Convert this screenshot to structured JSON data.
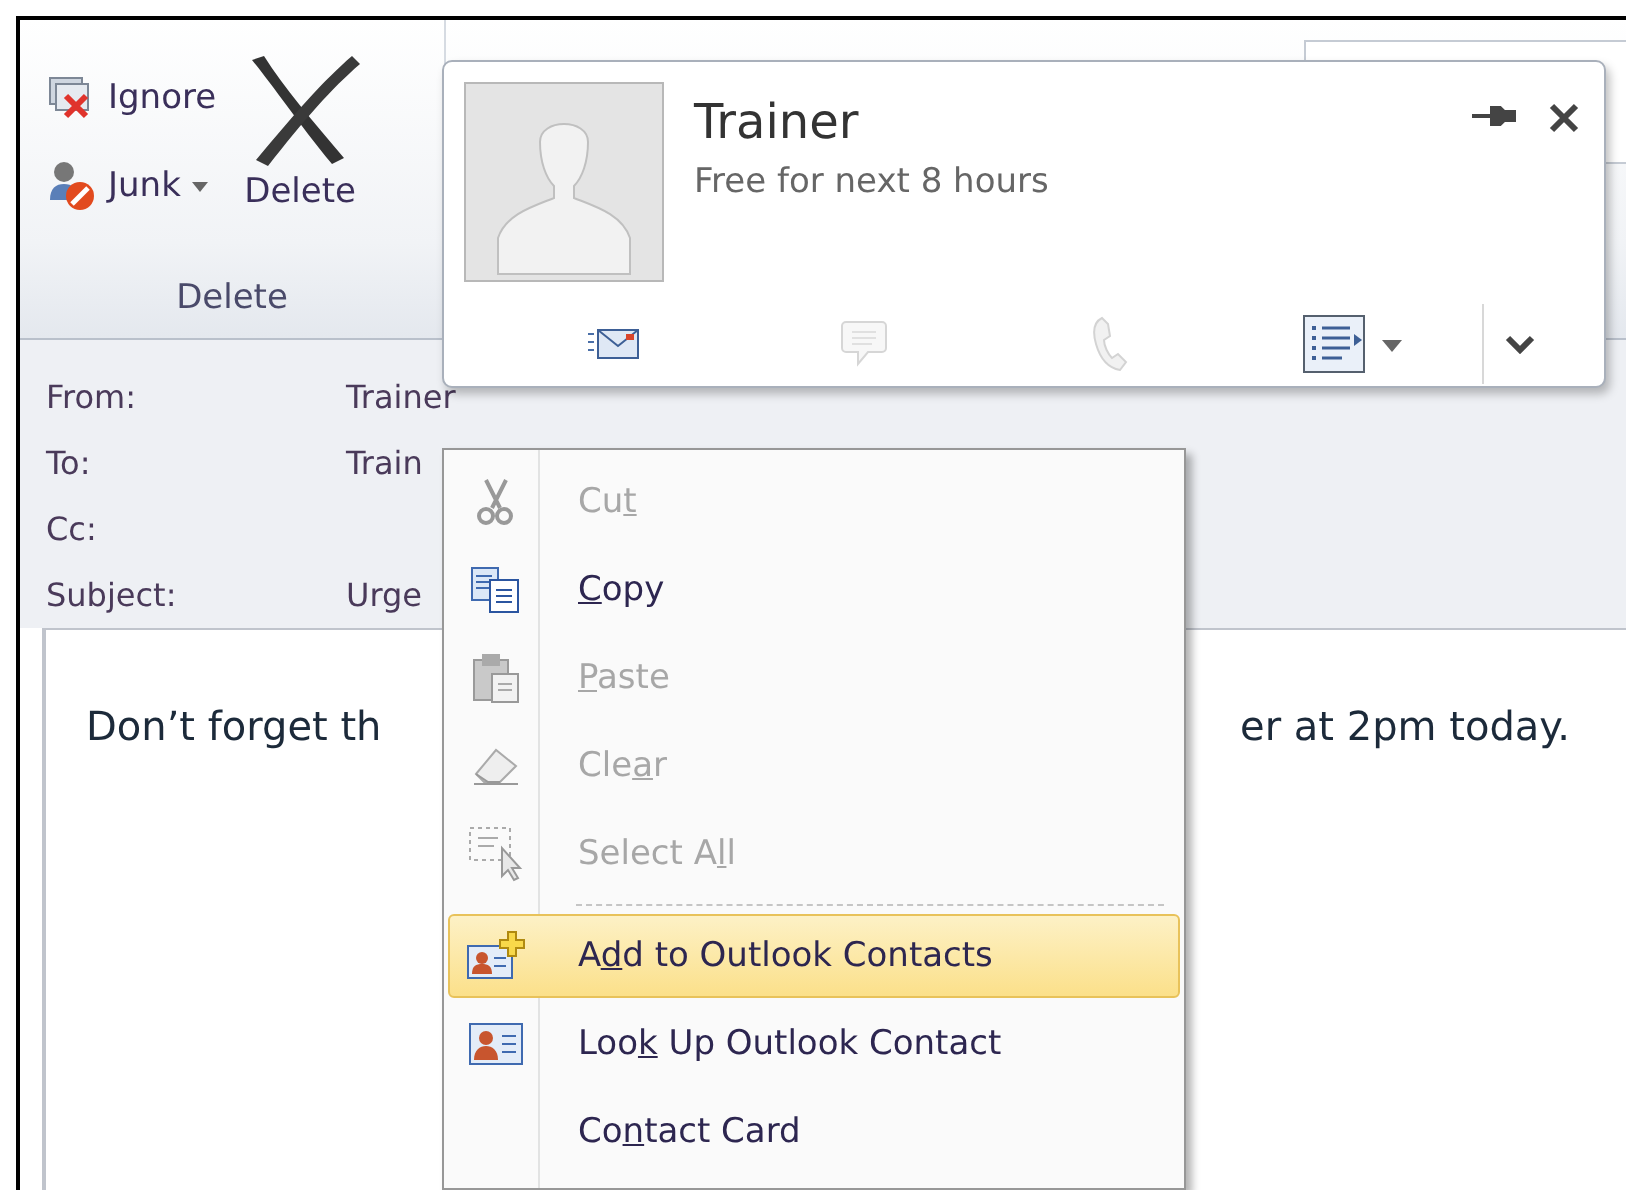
{
  "ribbon": {
    "group_label": "Delete",
    "buttons": [
      {
        "kind": "ignore",
        "label": "Ignore"
      },
      {
        "kind": "junk",
        "label": "Junk",
        "dropdown": true
      },
      {
        "kind": "delete",
        "label": "Delete"
      }
    ]
  },
  "contact_card": {
    "name": "Trainer",
    "status": "Free for next 8 hours",
    "actions": [
      {
        "kind": "email",
        "disabled": false
      },
      {
        "kind": "chat",
        "disabled": true
      },
      {
        "kind": "phone",
        "disabled": true
      },
      {
        "kind": "details",
        "disabled": false
      }
    ]
  },
  "header": {
    "fields": [
      {
        "label": "From:",
        "value": "Trainer"
      },
      {
        "label": "To:",
        "value": "Train"
      },
      {
        "label": "Cc:"
      },
      {
        "label": "Subject:",
        "value": "Urge"
      }
    ]
  },
  "body": {
    "text_left": "Don’t forget th",
    "text_right": "er at 2pm today."
  },
  "context_menu": {
    "items": [
      {
        "kind": "cut",
        "label": {
          "before": "Cu",
          "key": "t"
        },
        "disabled": true,
        "selected": false
      },
      {
        "kind": "copy",
        "label": {
          "key": "C",
          "after": "opy"
        },
        "disabled": false,
        "selected": false
      },
      {
        "kind": "paste",
        "label": {
          "key": "P",
          "after": "aste"
        },
        "disabled": true,
        "selected": false
      },
      {
        "kind": "clear",
        "label": {
          "before": "Cle",
          "key": "a",
          "after": "r"
        },
        "disabled": true,
        "selected": false
      },
      {
        "kind": "select-all",
        "label": {
          "before": "Select A",
          "key": "l",
          "after": "l"
        },
        "disabled": true,
        "selected": false
      },
      {
        "kind": "separator"
      },
      {
        "kind": "add-contact",
        "label": {
          "before": "A",
          "key": "d",
          "after": "d to Outlook Contacts"
        },
        "disabled": false,
        "selected": true
      },
      {
        "kind": "lookup-contact",
        "label": {
          "before": "Loo",
          "key": "k",
          "after": " Up Outlook Contact"
        },
        "disabled": false,
        "selected": false
      },
      {
        "kind": "contact-card",
        "label": {
          "before": "Co",
          "key": "n",
          "after": "tact Card"
        },
        "disabled": false,
        "selected": false
      }
    ]
  }
}
